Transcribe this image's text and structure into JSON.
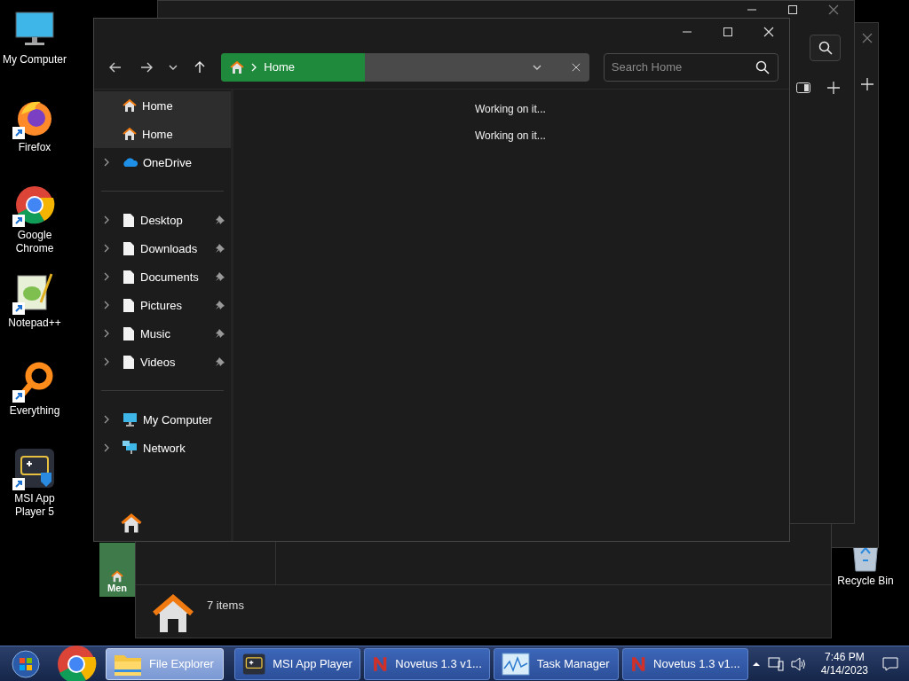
{
  "desktop_icons": [
    {
      "kind": "monitor",
      "label": "My Computer",
      "shortcut": false
    },
    {
      "kind": "firefox",
      "label": "Firefox",
      "shortcut": true
    },
    {
      "kind": "chrome",
      "label": "Google Chrome",
      "shortcut": true
    },
    {
      "kind": "notepad",
      "label": "Notepad++",
      "shortcut": true
    },
    {
      "kind": "ring",
      "label": "Everything",
      "shortcut": true
    },
    {
      "kind": "gamepad",
      "label": "MSI App Player 5",
      "shortcut": true
    }
  ],
  "recycle_bin": {
    "label": "Recycle Bin"
  },
  "menu_tile": {
    "label": "Men"
  },
  "back_window": {
    "status": "7 items"
  },
  "explorer": {
    "address": {
      "path": "Home",
      "level": 0.39
    },
    "search": {
      "placeholder": "Search Home"
    },
    "sidebar": {
      "groups": [
        [
          {
            "kind": "home",
            "label": "Home",
            "expandable": false,
            "pinned": false,
            "selected": true
          },
          {
            "kind": "home",
            "label": "Home",
            "expandable": false,
            "pinned": false,
            "selected": true
          },
          {
            "kind": "cloud",
            "label": "OneDrive",
            "expandable": true,
            "pinned": false,
            "selected": false
          }
        ],
        [
          {
            "kind": "file",
            "label": "Desktop",
            "expandable": true,
            "pinned": true,
            "selected": false
          },
          {
            "kind": "file",
            "label": "Downloads",
            "expandable": true,
            "pinned": true,
            "selected": false
          },
          {
            "kind": "file",
            "label": "Documents",
            "expandable": true,
            "pinned": true,
            "selected": false
          },
          {
            "kind": "file",
            "label": "Pictures",
            "expandable": true,
            "pinned": true,
            "selected": false
          },
          {
            "kind": "file",
            "label": "Music",
            "expandable": true,
            "pinned": true,
            "selected": false
          },
          {
            "kind": "file",
            "label": "Videos",
            "expandable": true,
            "pinned": true,
            "selected": false
          }
        ],
        [
          {
            "kind": "computer",
            "label": "My Computer",
            "expandable": true,
            "pinned": false,
            "selected": false
          },
          {
            "kind": "network",
            "label": "Network",
            "expandable": true,
            "pinned": false,
            "selected": false
          }
        ]
      ]
    },
    "messages": [
      "Working on it...",
      "Working on it..."
    ]
  },
  "taskbar": {
    "items": [
      {
        "kind": "folder",
        "label": "File Explorer",
        "selected": true
      },
      {
        "kind": "gamepad",
        "label": "MSI App Player",
        "selected": false
      },
      {
        "kind": "novetus",
        "label": "Novetus 1.3 v1...",
        "selected": false
      },
      {
        "kind": "chart",
        "label": "Task Manager",
        "selected": false
      },
      {
        "kind": "novetus",
        "label": "Novetus 1.3 v1...",
        "selected": false
      }
    ],
    "time": "7:46 PM",
    "date": "4/14/2023"
  }
}
